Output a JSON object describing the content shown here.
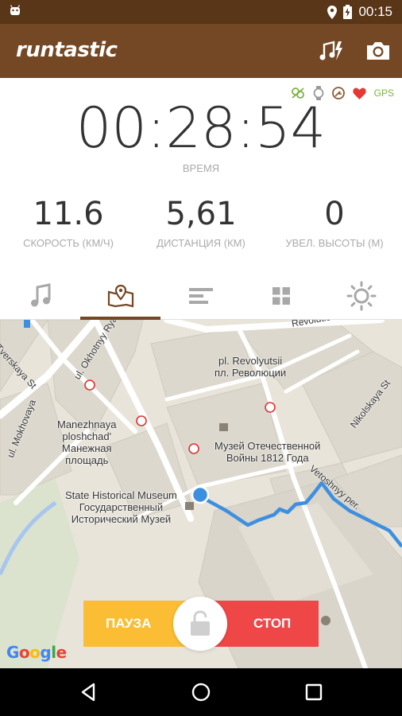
{
  "status_bar": {
    "time": "00:15",
    "icons": [
      "android-icon",
      "location-pin-icon",
      "battery-charging-icon"
    ]
  },
  "app_bar": {
    "logo": "runtastic",
    "actions": [
      "music-boost-icon",
      "camera-icon"
    ]
  },
  "sensors": {
    "icons": [
      "heart-rate-link-icon",
      "watch-icon",
      "sensor-icon",
      "heart-icon"
    ],
    "gps_label": "GPS",
    "colors": {
      "sensor_green": "#7cb342",
      "heart_red": "#e53935",
      "gps_green": "#7cb342"
    }
  },
  "timer": {
    "value": "00:28:54",
    "label": "ВРЕМЯ"
  },
  "metrics": [
    {
      "value": "11.6",
      "label": "СКОРОСТЬ (КМ/Ч)"
    },
    {
      "value": "5,61",
      "label": "ДИСТАНЦИЯ (КМ)"
    },
    {
      "value": "0",
      "label": "УВЕЛ. ВЫСОТЫ (М)"
    }
  ],
  "tabs": [
    {
      "icon": "music-note-icon",
      "active": false
    },
    {
      "icon": "map-icon",
      "active": true
    },
    {
      "icon": "split-table-icon",
      "active": false
    },
    {
      "icon": "dashboard-grid-icon",
      "active": false
    },
    {
      "icon": "brightness-icon",
      "active": false
    }
  ],
  "map": {
    "labels": {
      "revolyutsii_lat": "pl. Revolyutsii",
      "revolyutsii_ru": "пл. Революции",
      "manezhnaya_lat": "Manezhnaya",
      "manezhnaya_lat2": "ploshchad'",
      "manezhnaya_ru1": "Манежная",
      "manezhnaya_ru2": "площадь",
      "museum_war_1": "Музей Отечественной",
      "museum_war_2": "Войны 1812 Года",
      "state_museum_1": "State Historical Museum",
      "state_museum_2": "Государственный",
      "state_museum_3": "Исторический Музей"
    },
    "streets": {
      "tverskaya": "Tverskaya St",
      "okhotny": "ul. Okhotnyy Ryad",
      "mokhovaya": "ul. Mokhovaya",
      "revolution": "Revolutio",
      "nikolskaya": "Nikolskaya St",
      "vetoshnyy": "Vetoshnyy per."
    },
    "attribution": "Google",
    "route_color": "#3d8fe0"
  },
  "controls": {
    "pause_label": "ПАУЗА",
    "stop_label": "СТОП",
    "lock_icon": "unlock-icon",
    "colors": {
      "pause": "#fbbd33",
      "stop": "#ef4648"
    }
  },
  "nav_bar": {
    "icons": [
      "back-icon",
      "home-icon",
      "recents-icon"
    ]
  }
}
